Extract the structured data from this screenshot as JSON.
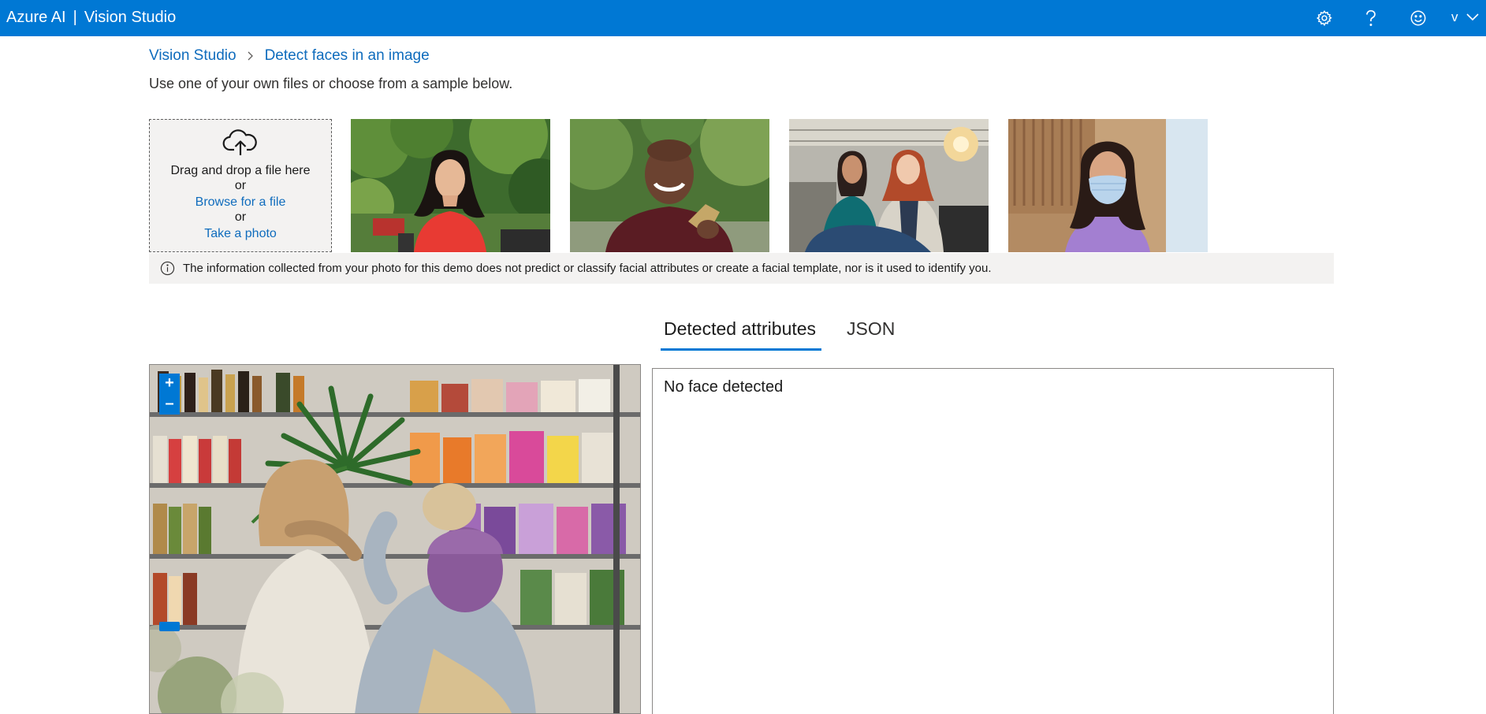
{
  "app": {
    "brand": "Azure AI",
    "separator": "|",
    "product": "Vision Studio",
    "user_initial": "v"
  },
  "header_icons": [
    "gear-icon",
    "help-icon",
    "feedback-smiley-icon",
    "chevron-down-icon"
  ],
  "breadcrumb": {
    "items": [
      "Vision Studio",
      "Detect faces in an image"
    ]
  },
  "intro_text": "Use one of your own files or choose from a sample below.",
  "upload": {
    "drag_text": "Drag and drop a file here",
    "or_text": "or",
    "browse_label": "Browse for a file",
    "photo_label": "Take a photo"
  },
  "samples": [
    {
      "name": "sample-woman-red-top"
    },
    {
      "name": "sample-man-smiling"
    },
    {
      "name": "sample-two-women-office"
    },
    {
      "name": "sample-woman-face-mask"
    }
  ],
  "notice": "The information collected from your photo for this demo does not predict or classify facial attributes or create a facial template, nor is it used to identify you.",
  "tabs": [
    {
      "label": "Detected attributes",
      "active": true
    },
    {
      "label": "JSON",
      "active": false
    }
  ],
  "viewer": {
    "zoom_in": "+",
    "zoom_out": "–"
  },
  "result": {
    "text": "No face detected"
  },
  "colors": {
    "accent": "#0078d4",
    "link": "#0f6cbd",
    "panel": "#f3f2f1"
  }
}
